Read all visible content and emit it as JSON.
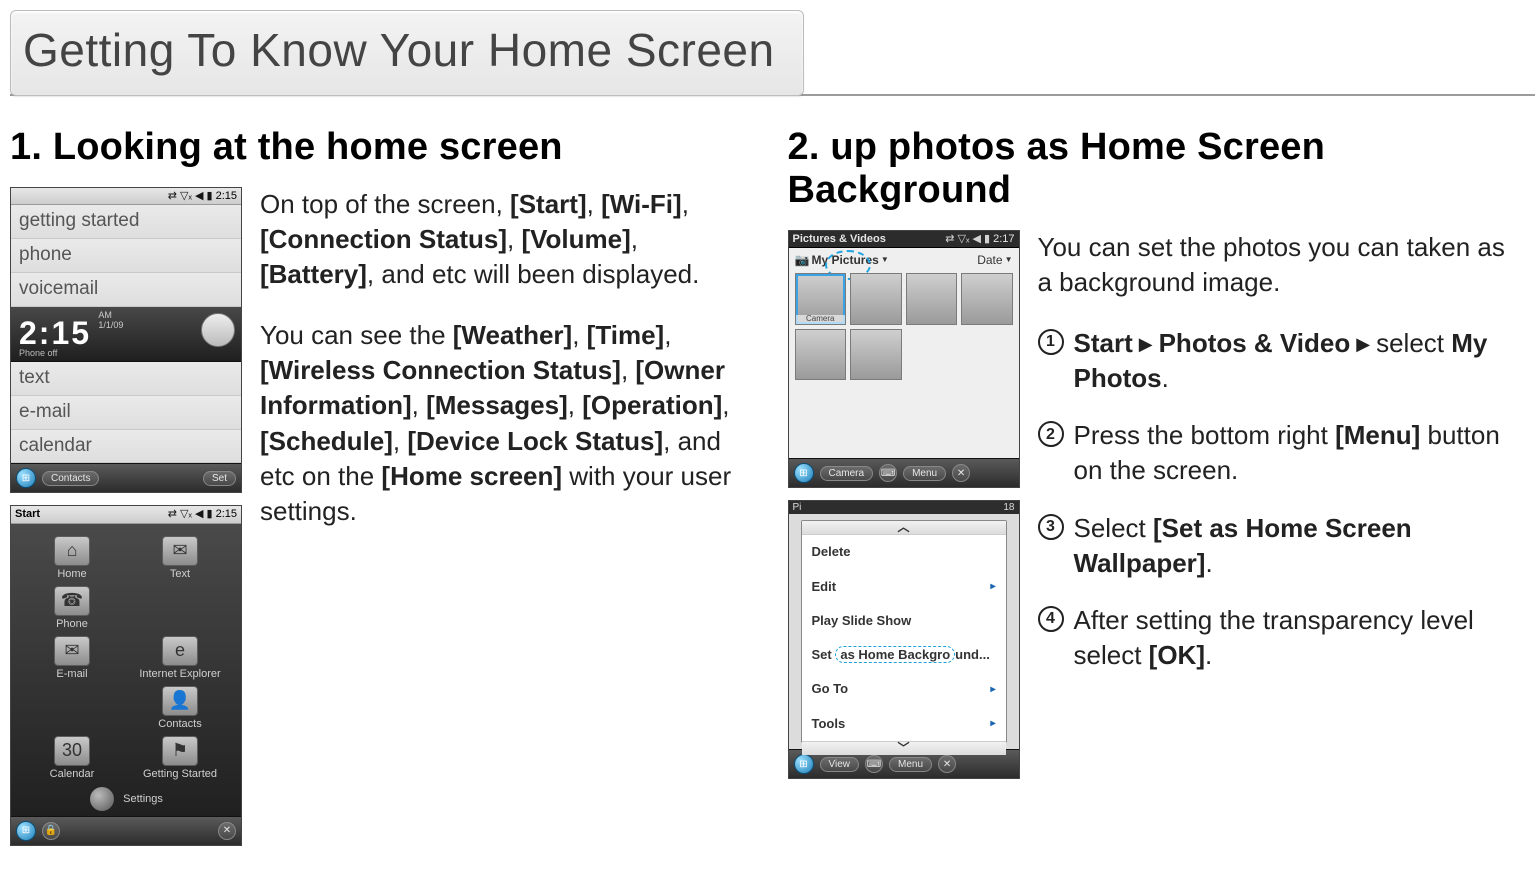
{
  "page_title": "Getting To Know Your Home Screen",
  "left": {
    "heading": "1. Looking at the home screen",
    "para1_pre": "On top of the screen, ",
    "para1_items": [
      "[Start]",
      "[Wi-Fi]",
      "[Connection Status]",
      "[Volume]",
      "[Battery]"
    ],
    "para1_post": ", and etc will been displayed.",
    "para2_pre": "You can see the ",
    "para2_items": [
      "[Weather]",
      "[Time]",
      "[Wireless Connection Status]",
      "[Owner Information]",
      "[Messages]",
      "[Operation]",
      "[Schedule]",
      "[Device Lock Status]"
    ],
    "para2_mid": ", and etc on the ",
    "para2_home": "[Home screen]",
    "para2_post": " with your user settings."
  },
  "right": {
    "heading": "2. up photos as Home Screen Background",
    "intro": "You can set the photos you can taken as a background image.",
    "steps": [
      {
        "prefix": "Start",
        "arrow1": "▶",
        "mid": "Photos & Video",
        "arrow2": "▶",
        "pre2": "select ",
        "bold": "My Photos",
        "post": "."
      },
      {
        "text_pre": "Press the bottom right ",
        "bold": "[Menu]",
        "text_post": " button on the screen."
      },
      {
        "text_pre": "Select ",
        "bold": "[Set as Home Screen Wallpaper]",
        "text_post": "."
      },
      {
        "text_pre": "After setting the transparency level select ",
        "bold": "[OK]",
        "text_post": "."
      }
    ]
  },
  "mock_home": {
    "status_time": "2:15",
    "rows": [
      "getting started",
      "phone",
      "voicemail"
    ],
    "clock_time": "2:15",
    "clock_ampm": "AM",
    "clock_date": "1/1/09",
    "clock_sub": "Phone off",
    "rows2": [
      "text",
      "e-mail",
      "calendar"
    ],
    "bottom_left": "Contacts",
    "bottom_right": "Set"
  },
  "mock_start": {
    "title": "Start",
    "status_time": "2:15",
    "items": [
      {
        "label": "Home",
        "glyph": "⌂"
      },
      {
        "label": "Text",
        "glyph": "✉"
      },
      {
        "label": "Phone",
        "glyph": "☎"
      },
      {
        "label": "",
        "glyph": ""
      },
      {
        "label": "E-mail",
        "glyph": "✉"
      },
      {
        "label": "Internet Explorer",
        "glyph": "e"
      },
      {
        "label": "",
        "glyph": ""
      },
      {
        "label": "Contacts",
        "glyph": "👤"
      },
      {
        "label": "Calendar",
        "glyph": "30"
      },
      {
        "label": "Getting Started",
        "glyph": "⚑"
      }
    ],
    "settings": "Settings"
  },
  "mock_pics": {
    "title": "Pictures & Videos",
    "status_time": "2:17",
    "folder": "My Pictures",
    "sort": "Date",
    "first_label": "Camera",
    "bottom_left": "Camera",
    "bottom_right": "Menu"
  },
  "mock_menu": {
    "status_right": "18",
    "items": [
      {
        "label": "Delete",
        "sub": false
      },
      {
        "label": "Edit",
        "sub": true
      },
      {
        "label": "Play Slide Show",
        "sub": false
      },
      {
        "label": "Set as Home Background...",
        "sub": false,
        "highlight": true
      },
      {
        "label": "Go To",
        "sub": true
      },
      {
        "label": "Tools",
        "sub": true
      }
    ],
    "bottom_left": "View",
    "bottom_right": "Menu"
  }
}
